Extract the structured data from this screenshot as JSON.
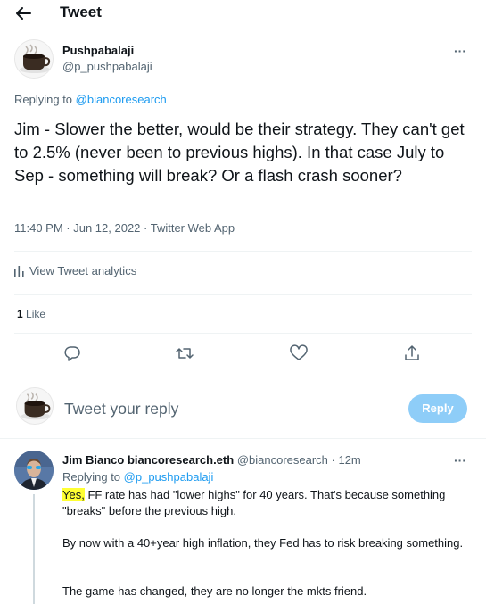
{
  "header": {
    "title": "Tweet"
  },
  "tweet": {
    "author_name": "Pushpabalaji",
    "author_handle": "@p_pushpabalaji",
    "replying_prefix": "Replying to",
    "replying_handle": "@biancoresearch",
    "text": "Jim - Slower the better, would be their strategy. They can't get to 2.5% (never been to previous highs). In that case July to Sep - something will break? Or a flash crash sooner?",
    "meta": "11:40 PM · Jun 12, 2022 · Twitter Web App",
    "analytics_label": "View Tweet analytics",
    "likes_count": "1",
    "likes_label": "Like"
  },
  "compose": {
    "placeholder": "Tweet your reply",
    "reply_button": "Reply"
  },
  "reply": {
    "author_name": "Jim Bianco biancoresearch.eth",
    "author_handle": "@biancoresearch",
    "time": "· 12m",
    "replying_prefix": "Replying to",
    "replying_handle": "@p_pushpabalaji",
    "highlight": "Yes,",
    "para1_rest": " FF rate has had \"lower highs\" for 40 years. That's because something \"breaks\" before the previous high.",
    "para2": "By now with a 40+year high inflation, they Fed has to risk breaking something.",
    "para3": "The game has changed, they are no longer the mkts friend."
  },
  "icons": {
    "back": "arrow-left-icon",
    "more": "more-horizontal-icon",
    "analytics": "bar-chart-icon",
    "reply": "speech-bubble-icon",
    "retweet": "retweet-icon",
    "like": "heart-icon",
    "share": "share-upload-icon"
  },
  "colors": {
    "accent": "#1d9bf0",
    "reply_button_disabled": "#8ecdf8",
    "highlight": "#ffff33",
    "secondary_text": "#536471"
  }
}
